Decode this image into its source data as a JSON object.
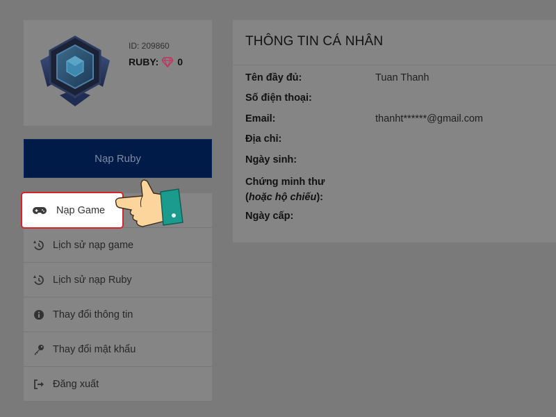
{
  "profile": {
    "id_text": "ID: 209860",
    "ruby_label": "RUBY:",
    "ruby_count": "0",
    "gem_color": "#d6336c"
  },
  "nap_ruby_button": "Nạp Ruby",
  "highlighted_item": {
    "label": "Nạp Game",
    "icon": "gamepad-icon"
  },
  "menu": [
    {
      "label": "Lịch sử nạp game",
      "icon": "history-icon"
    },
    {
      "label": "Lịch sử nạp Ruby",
      "icon": "history-icon"
    },
    {
      "label": "Thay đổi thông tin",
      "icon": "info-icon"
    },
    {
      "label": "Thay đổi mật khẩu",
      "icon": "key-icon"
    },
    {
      "label": "Đăng xuất",
      "icon": "logout-icon"
    }
  ],
  "info": {
    "title": "THÔNG TIN CÁ NHÂN",
    "fields": {
      "full_name_label": "Tên đầy đủ:",
      "full_name_value": "Tuan Thanh",
      "phone_label": "Số điện thoại:",
      "email_label": "Email:",
      "email_value": "thanht******@gmail.com",
      "address_label": "Địa chỉ:",
      "dob_label": "Ngày sinh:",
      "id_card_label_line1": "Chứng minh thư",
      "id_card_label_line2_open": "(",
      "id_card_label_line2_italic": "hoặc hộ chiếu",
      "id_card_label_line2_close": "):",
      "issue_date_label": "Ngày cấp:"
    }
  }
}
